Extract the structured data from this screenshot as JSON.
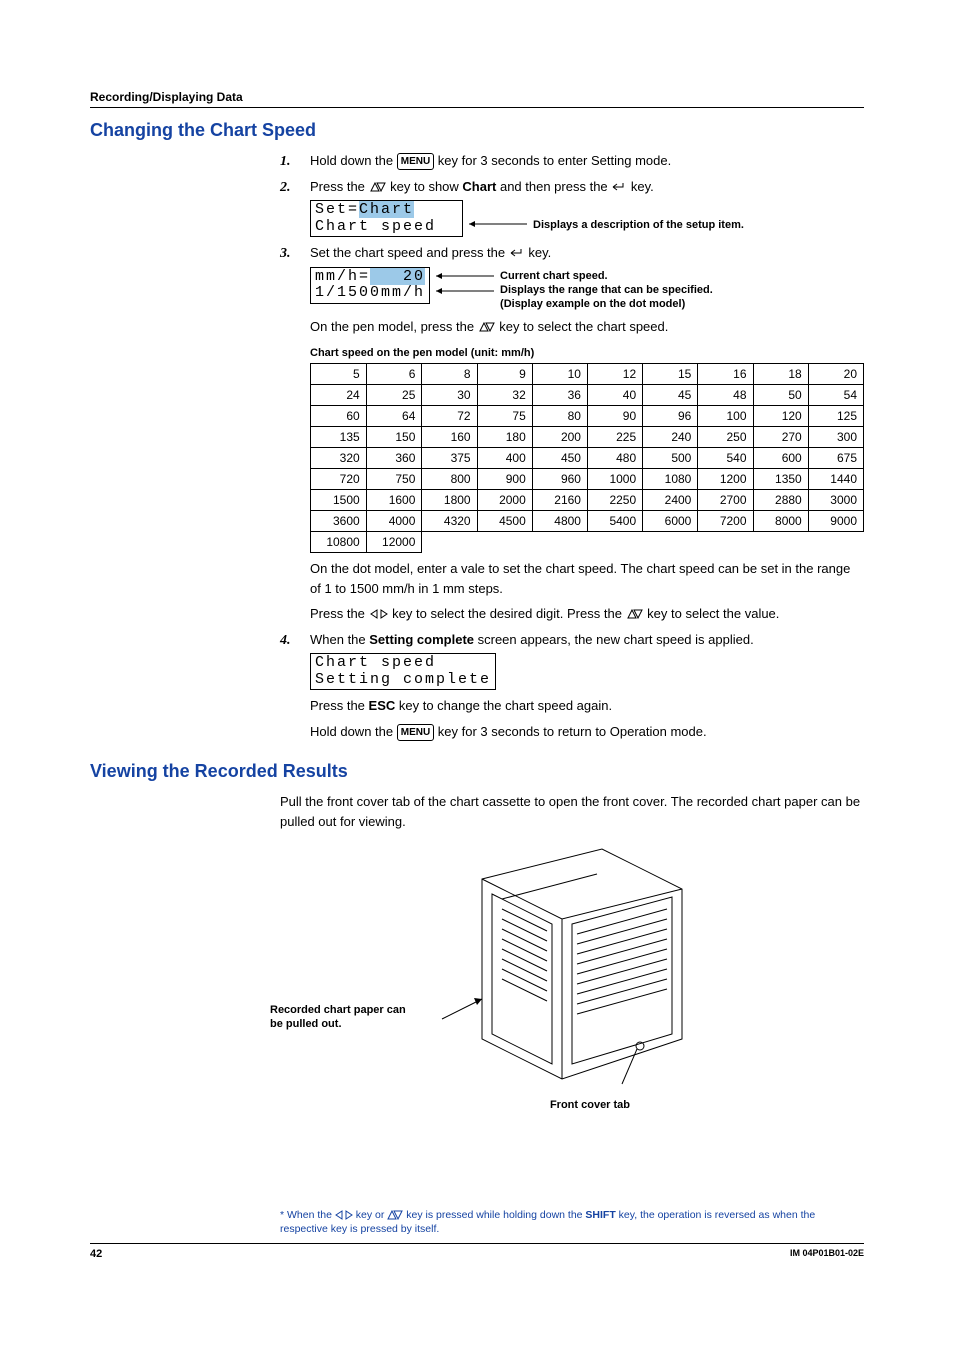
{
  "running_head": "Recording/Displaying Data",
  "section1_title": "Changing the Chart Speed",
  "steps": {
    "s1": {
      "num": "1.",
      "pre": "Hold down the ",
      "menu": "MENU",
      "post": " key for 3 seconds to enter Setting mode."
    },
    "s2": {
      "num": "2.",
      "pre": "Press the ",
      "mid": " key to show ",
      "chart_word": "Chart",
      "post": " and then press the ",
      "end": " key."
    },
    "lcd1_a": "Set=",
    "lcd1_a_hl": "Chart",
    "lcd1_b": "Chart speed",
    "annot1": "Displays a description of the setup item.",
    "s3": {
      "num": "3.",
      "pre": "Set the chart speed and press the ",
      "post": " key."
    },
    "lcd2_a_pre": "mm/h=",
    "lcd2_a_hl": "   20",
    "lcd2_b": "1/1500mm/h",
    "annot2a": "Current chart speed.",
    "annot2b": "Displays the range that can be specified.",
    "annot2c": "(Display example on the dot model)",
    "pen_line_pre": "On the pen model, press the ",
    "pen_line_post": " key to select the chart speed.",
    "table_caption": "Chart speed on the pen model (unit: mm/h)",
    "dot_para1": "On the dot model, enter a vale to set the chart speed. The chart speed can be set in the range of 1 to 1500 mm/h in 1 mm steps.",
    "dot_para2_pre": "Press the ",
    "dot_para2_mid": " key to select the desired digit. Press the ",
    "dot_para2_post": " key to select the value.",
    "s4": {
      "num": "4.",
      "pre": "When the ",
      "bold": "Setting complete",
      "post": " screen appears, the new chart speed is applied."
    },
    "lcd3_a": "Chart speed",
    "lcd3_b": "Setting complete",
    "s4_p2_pre": "Press the ",
    "s4_p2_bold": "ESC",
    "s4_p2_post": " key to change the chart speed again.",
    "s4_p3_pre": "Hold down the ",
    "s4_p3_menu": "MENU",
    "s4_p3_post": " key for 3 seconds to return to Operation mode."
  },
  "chart_data": {
    "type": "table",
    "title": "Chart speed on the pen model (unit: mm/h)",
    "rows": [
      [
        5,
        6,
        8,
        9,
        10,
        12,
        15,
        16,
        18,
        20
      ],
      [
        24,
        25,
        30,
        32,
        36,
        40,
        45,
        48,
        50,
        54
      ],
      [
        60,
        64,
        72,
        75,
        80,
        90,
        96,
        100,
        120,
        125
      ],
      [
        135,
        150,
        160,
        180,
        200,
        225,
        240,
        250,
        270,
        300
      ],
      [
        320,
        360,
        375,
        400,
        450,
        480,
        500,
        540,
        600,
        675
      ],
      [
        720,
        750,
        800,
        900,
        960,
        1000,
        1080,
        1200,
        1350,
        1440
      ],
      [
        1500,
        1600,
        1800,
        2000,
        2160,
        2250,
        2400,
        2700,
        2880,
        3000
      ],
      [
        3600,
        4000,
        4320,
        4500,
        4800,
        5400,
        6000,
        7200,
        8000,
        9000
      ],
      [
        10800,
        12000,
        null,
        null,
        null,
        null,
        null,
        null,
        null,
        null
      ]
    ]
  },
  "section2_title": "Viewing the Recorded Results",
  "section2_para": "Pull the front cover tab of the chart cassette to open the front cover. The recorded chart paper can be pulled out for viewing.",
  "dev_label_paper": "Recorded chart paper can be pulled out.",
  "dev_label_tab": "Front cover tab",
  "footnote_pre": "*   When the ",
  "footnote_mid1": " key or ",
  "footnote_mid2": " key is pressed while holding down the ",
  "footnote_shift": "SHIFT",
  "footnote_post": " key, the operation is reversed as when the respective key is pressed by itself.",
  "page_number": "42",
  "doc_id": "IM 04P01B01-02E"
}
